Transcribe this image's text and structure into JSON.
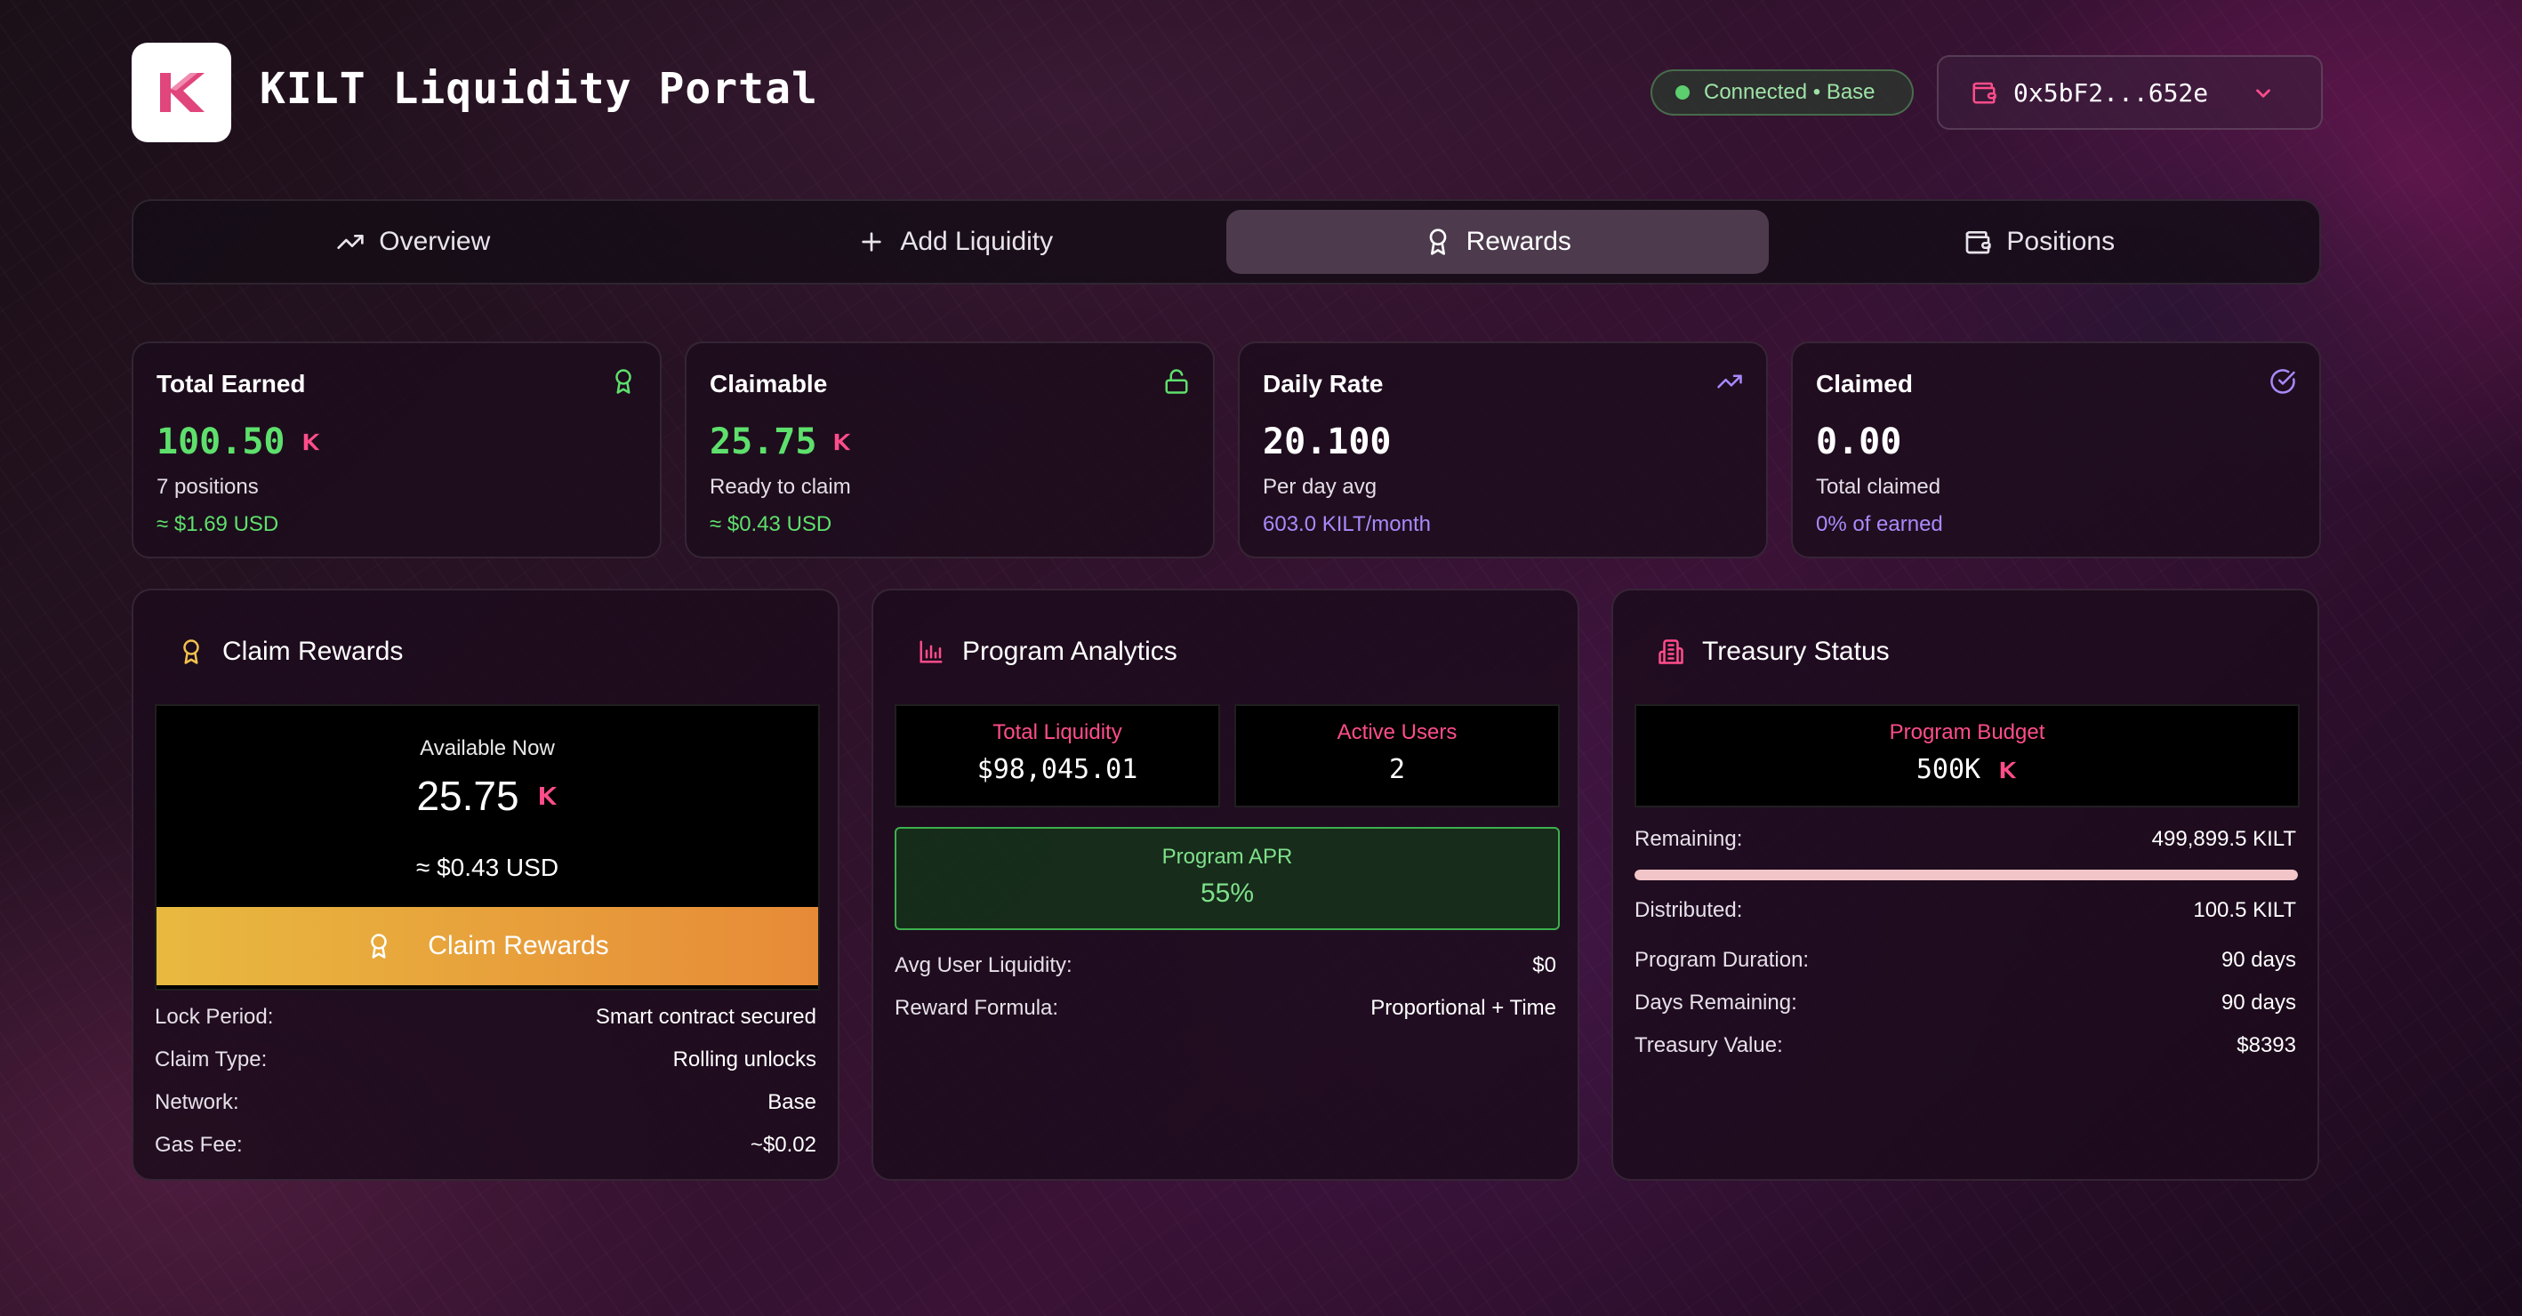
{
  "header": {
    "title": "KILT Liquidity Portal",
    "status": "Connected • Base",
    "wallet_address": "0x5bF2...652e"
  },
  "tabs": [
    {
      "label": "Overview",
      "icon": "trending-up-icon"
    },
    {
      "label": "Add Liquidity",
      "icon": "plus-icon"
    },
    {
      "label": "Rewards",
      "icon": "award-icon",
      "active": true
    },
    {
      "label": "Positions",
      "icon": "wallet-icon"
    }
  ],
  "stats": {
    "total_earned": {
      "label": "Total Earned",
      "value": "100.50",
      "sub": "7 positions",
      "sub2": "≈ $1.69 USD"
    },
    "claimable": {
      "label": "Claimable",
      "value": "25.75",
      "sub": "Ready to claim",
      "sub2": "≈ $0.43 USD"
    },
    "daily_rate": {
      "label": "Daily Rate",
      "value": "20.100",
      "sub": "Per day avg",
      "sub2": "603.0 KILT/month"
    },
    "claimed": {
      "label": "Claimed",
      "value": "0.00",
      "sub": "Total claimed",
      "sub2": "0% of earned"
    }
  },
  "claim_panel": {
    "title": "Claim Rewards",
    "available_label": "Available Now",
    "available_value": "25.75",
    "available_usd": "≈ $0.43 USD",
    "button_label": "Claim Rewards",
    "rows": [
      {
        "k": "Lock Period:",
        "v": "Smart contract secured"
      },
      {
        "k": "Claim Type:",
        "v": "Rolling unlocks"
      },
      {
        "k": "Network:",
        "v": "Base"
      },
      {
        "k": "Gas Fee:",
        "v": "~$0.02"
      }
    ]
  },
  "analytics_panel": {
    "title": "Program Analytics",
    "total_liquidity_label": "Total Liquidity",
    "total_liquidity_value": "$98,045.01",
    "active_users_label": "Active Users",
    "active_users_value": "2",
    "apr_label": "Program APR",
    "apr_value": "55%",
    "rows": [
      {
        "k": "Avg User Liquidity:",
        "v": "$0"
      },
      {
        "k": "Reward Formula:",
        "v": "Proportional + Time"
      }
    ]
  },
  "treasury_panel": {
    "title": "Treasury Status",
    "budget_label": "Program Budget",
    "budget_value": "500K",
    "remaining_label": "Remaining:",
    "remaining_value": "499,899.5 KILT",
    "remaining_fraction": 0.9998,
    "rows": [
      {
        "k": "Distributed:",
        "v": "100.5 KILT"
      },
      {
        "k": "Program Duration:",
        "v": "90 days"
      },
      {
        "k": "Days Remaining:",
        "v": "90 days"
      },
      {
        "k": "Treasury Value:",
        "v": "$8393"
      }
    ]
  },
  "colors": {
    "accent_pink": "#ff4d8a",
    "green": "#5ee06c",
    "purple": "#a78bfa",
    "orange_start": "#e8b93f",
    "orange_end": "#e78a38"
  }
}
